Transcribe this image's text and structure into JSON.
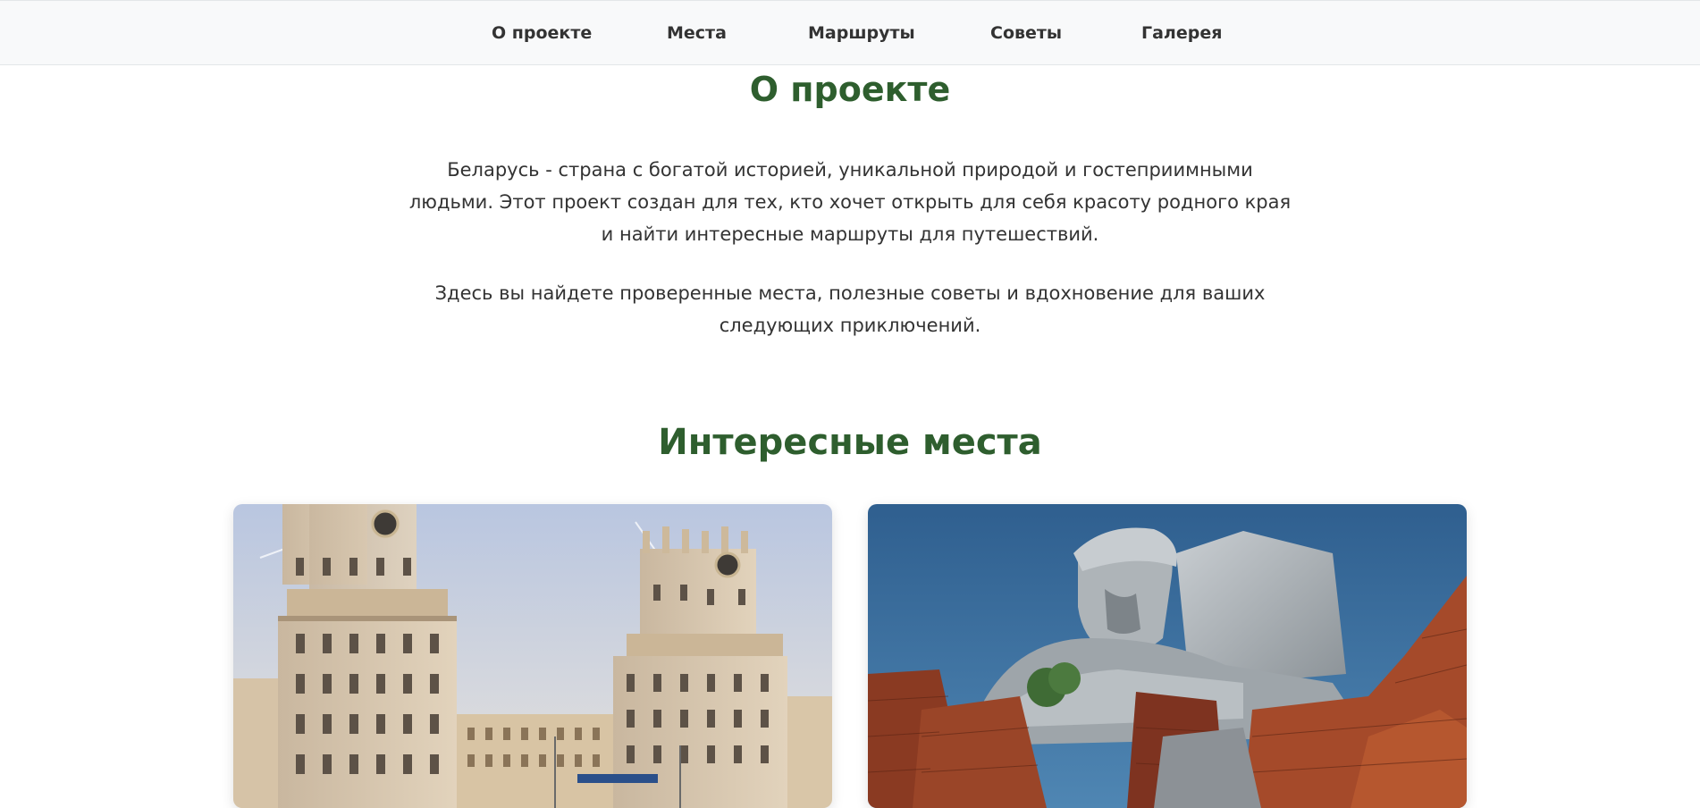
{
  "nav": {
    "items": [
      {
        "label": "О проекте"
      },
      {
        "label": "Места"
      },
      {
        "label": "Маршруты"
      },
      {
        "label": "Советы"
      },
      {
        "label": "Галерея"
      }
    ]
  },
  "about": {
    "title": "О проекте",
    "paragraph1": "Беларусь - страна с богатой историей, уникальной природой и гостеприимными людьми. Этот проект создан для тех, кто хочет открыть для себя красоту родного края и найти интересные маршруты для путешествий.",
    "paragraph2": "Здесь вы найдете проверенные места, полезные советы и вдохновение для ваших следующих приключений."
  },
  "places": {
    "title": "Интересные места"
  },
  "colors": {
    "heading": "#2e5e2e",
    "navbar_bg": "#f8f9fa"
  }
}
